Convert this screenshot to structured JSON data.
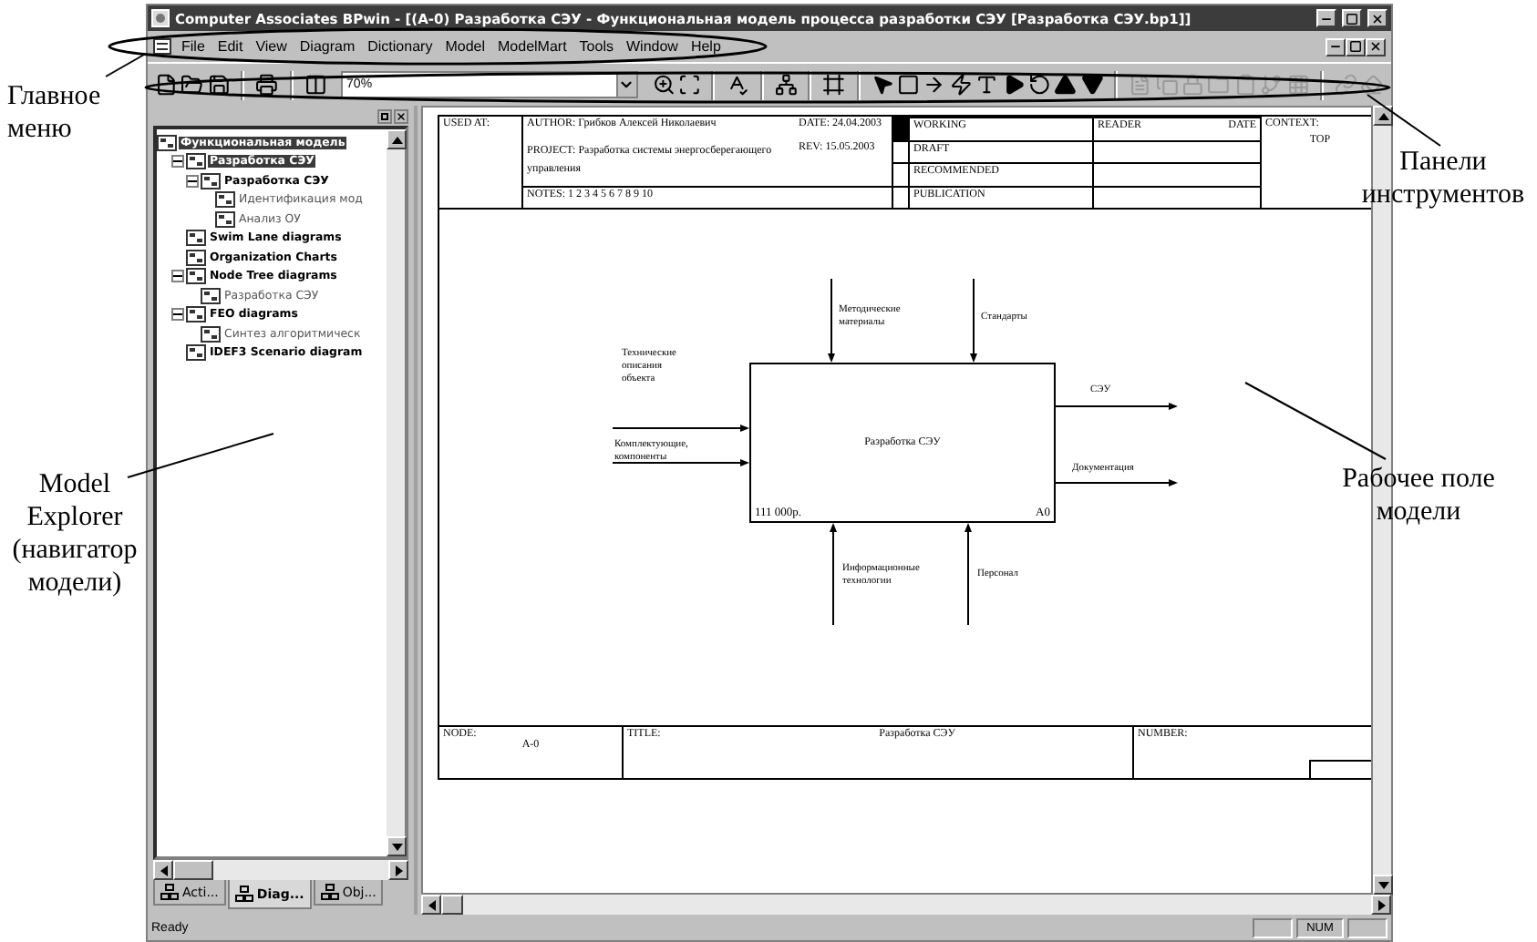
{
  "window": {
    "title": "Computer Associates BPwin - [(A-0) Разработка СЭУ - Функциональная модель процесса разработки  СЭУ  [Разработка СЭУ.bp1]]"
  },
  "menu": [
    "File",
    "Edit",
    "View",
    "Diagram",
    "Dictionary",
    "Model",
    "ModelMart",
    "Tools",
    "Window",
    "Help"
  ],
  "toolbar": {
    "groups_before_zoom": [
      [
        {
          "kind": "new",
          "disabled": false
        },
        {
          "kind": "open",
          "disabled": false
        },
        {
          "kind": "save",
          "disabled": false
        }
      ],
      [
        {
          "kind": "print",
          "disabled": false
        }
      ],
      [
        {
          "kind": "columns",
          "disabled": false
        }
      ]
    ],
    "zoom": "70%",
    "groups_after_zoom": [
      [
        {
          "kind": "zoom_in",
          "disabled": false
        },
        {
          "kind": "zoom_fit",
          "disabled": false
        }
      ],
      [
        {
          "kind": "spell",
          "disabled": false
        }
      ],
      [
        {
          "kind": "hierarchy",
          "disabled": false
        }
      ],
      [
        {
          "kind": "frame",
          "disabled": false
        }
      ],
      [
        {
          "kind": "pointer",
          "disabled": false
        },
        {
          "kind": "box",
          "disabled": false
        },
        {
          "kind": "arrow",
          "disabled": false
        },
        {
          "kind": "squiggle",
          "disabled": false
        },
        {
          "kind": "text",
          "disabled": false
        },
        {
          "kind": "play",
          "disabled": false
        },
        {
          "kind": "rotate",
          "disabled": false
        },
        {
          "kind": "up",
          "disabled": false
        },
        {
          "kind": "down",
          "disabled": false
        }
      ],
      [
        {
          "kind": "page",
          "disabled": true
        },
        {
          "kind": "copy",
          "disabled": true
        },
        {
          "kind": "lock",
          "disabled": true
        },
        {
          "kind": "folder",
          "disabled": true
        },
        {
          "kind": "paste",
          "disabled": true
        },
        {
          "kind": "branch",
          "disabled": true
        },
        {
          "kind": "grid",
          "disabled": true
        }
      ],
      [
        {
          "kind": "link",
          "disabled": true
        },
        {
          "kind": "eraser",
          "disabled": true
        }
      ]
    ]
  },
  "explorer": {
    "tree": [
      {
        "label": "Функциональная модель",
        "kind": "group",
        "selected": true,
        "children": [
          {
            "label": "Разработка СЭУ",
            "kind": "group",
            "selected": true,
            "expanded": true,
            "children": [
              {
                "label": "Разработка СЭУ",
                "kind": "group",
                "selected": false,
                "expanded": true,
                "children": [
                  {
                    "label": "Идентификация мод",
                    "kind": "diagram",
                    "selected": false
                  },
                  {
                    "label": "Анализ ОУ",
                    "kind": "diagram",
                    "selected": false
                  }
                ]
              }
            ]
          },
          {
            "label": "Swim Lane diagrams",
            "kind": "group",
            "selected": false
          },
          {
            "label": "Organization Charts",
            "kind": "group",
            "selected": false
          },
          {
            "label": "Node Tree diagrams",
            "kind": "group",
            "selected": false,
            "expanded": true,
            "children": [
              {
                "label": "Разработка СЭУ",
                "kind": "diagram",
                "selected": false
              }
            ]
          },
          {
            "label": "FEO diagrams",
            "kind": "group",
            "selected": false,
            "expanded": true,
            "children": [
              {
                "label": "Синтез алгоритмическ",
                "kind": "diagram",
                "selected": false
              }
            ]
          },
          {
            "label": "IDEF3 Scenario diagram",
            "kind": "group",
            "selected": false
          }
        ]
      }
    ],
    "tabs": [
      {
        "label": "Acti...",
        "selected": false
      },
      {
        "label": "Diag...",
        "selected": true
      },
      {
        "label": "Obj...",
        "selected": false
      }
    ]
  },
  "diagram": {
    "header": {
      "used_at": "USED AT:",
      "author": "AUTHOR:  Грибков Алексей Николаевич",
      "project": "PROJECT:  Разработка системы энергосберегающего управления",
      "notes": "NOTES:  1  2  3  4  5  6  7  8  9  10",
      "date": "DATE: 24.04.2003",
      "rev": "REV:    15.05.2003",
      "statuses": [
        {
          "label": "WORKING",
          "selected": true
        },
        {
          "label": "DRAFT",
          "selected": false
        },
        {
          "label": "RECOMMENDED",
          "selected": false
        },
        {
          "label": "PUBLICATION",
          "selected": false
        }
      ],
      "reader": "READER",
      "reader_date": "DATE",
      "context": "CONTEXT:",
      "context_value": "TOP"
    },
    "activity": {
      "name": "Разработка СЭУ",
      "cost": "111 000р.",
      "number": "A0"
    },
    "arrows": [
      {
        "kind": "input",
        "label": "Технические описания объекта"
      },
      {
        "kind": "input",
        "label": "Комплектующие, компоненты"
      },
      {
        "kind": "control",
        "label": "Методические материалы"
      },
      {
        "kind": "control",
        "label": "Стандарты"
      },
      {
        "kind": "output",
        "label": "СЭУ"
      },
      {
        "kind": "output",
        "label": "Документация"
      },
      {
        "kind": "mechanism",
        "label": "Информационные технологии"
      },
      {
        "kind": "mechanism",
        "label": "Персонал"
      }
    ],
    "footer": {
      "node_label": "NODE:",
      "node": "A-0",
      "title_label": "TITLE:",
      "title": "Разработка СЭУ",
      "number_label": "NUMBER:"
    }
  },
  "status_bar": {
    "text": "Ready",
    "num": "NUM"
  },
  "annotations": [
    {
      "kind": "menu",
      "text": "Главное меню"
    },
    {
      "kind": "toolbars",
      "text": "Панели инструментов"
    },
    {
      "kind": "explorer",
      "text": "Model Explorer (навигатор модели)"
    },
    {
      "kind": "workspace",
      "text": "Рабочее поле модели"
    }
  ]
}
